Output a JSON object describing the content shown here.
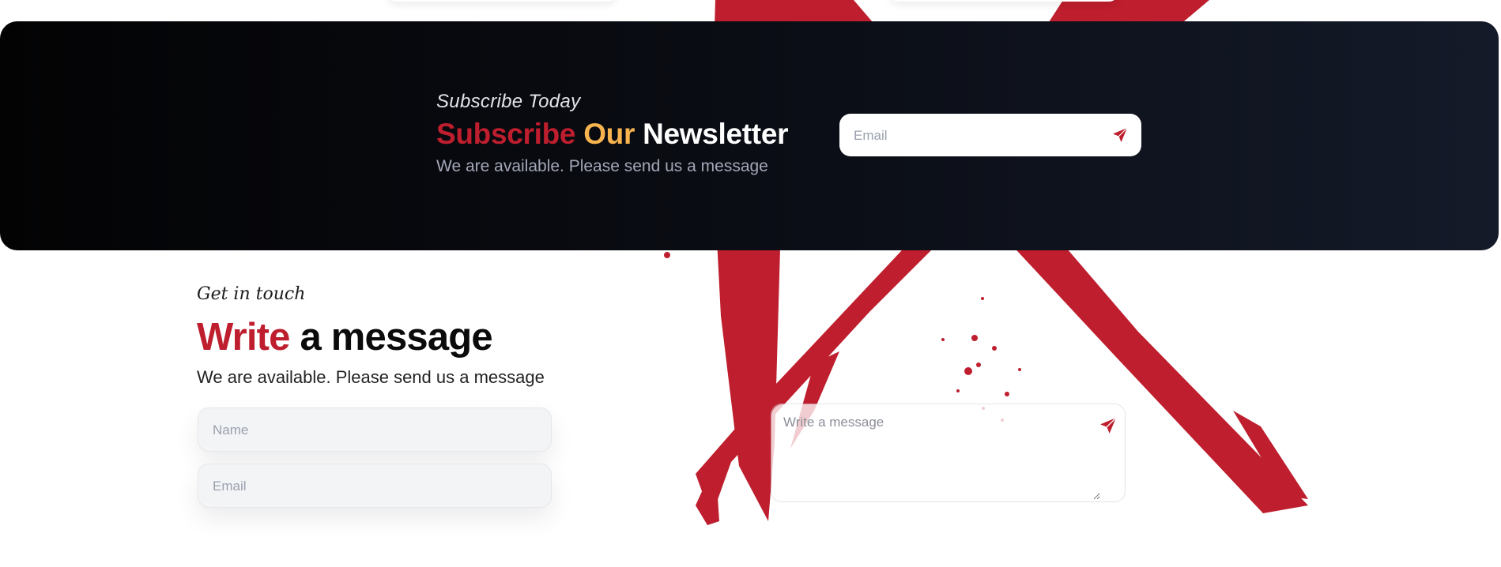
{
  "newsletter": {
    "kicker": "Subscribe Today",
    "heading_word1": "Subscribe",
    "heading_word2": "Our",
    "heading_word3": "Newsletter",
    "subtext": "We are available. Please send us a message",
    "email_placeholder": "Email",
    "send_icon": "paper-plane-icon"
  },
  "contact": {
    "kicker": "Get in touch",
    "heading_word1": "Write",
    "heading_word2": "a message",
    "subtext": "We are available. Please send us a message",
    "name_placeholder": "Name",
    "email_placeholder": "Email",
    "message_placeholder": "Write a message",
    "send_icon": "paper-plane-icon"
  },
  "colors": {
    "accent_red": "#be1e2d",
    "accent_gold": "#f7b34e",
    "banner_dark": "#0b0e16"
  }
}
